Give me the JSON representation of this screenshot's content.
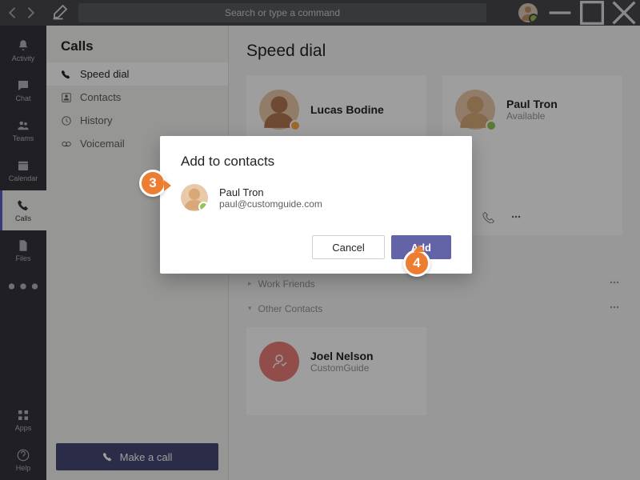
{
  "titlebar": {
    "search_placeholder": "Search or type a command"
  },
  "rail": {
    "activity": "Activity",
    "chat": "Chat",
    "teams": "Teams",
    "calendar": "Calendar",
    "calls": "Calls",
    "files": "Files",
    "apps": "Apps",
    "help": "Help"
  },
  "calls_panel": {
    "title": "Calls",
    "items": {
      "speed_dial": "Speed dial",
      "contacts": "Contacts",
      "history": "History",
      "voicemail": "Voicemail"
    },
    "make_call": "Make a call"
  },
  "content": {
    "title": "Speed dial",
    "contacts": [
      {
        "name": "Lucas Bodine",
        "status": ""
      },
      {
        "name": "Paul Tron",
        "status": "Available"
      }
    ],
    "groups": {
      "work_friends": "Work Friends",
      "other_contacts": "Other Contacts"
    },
    "joel": {
      "name": "Joel Nelson",
      "status": "CustomGuide"
    }
  },
  "modal": {
    "title": "Add to contacts",
    "name": "Paul Tron",
    "email": "paul@customguide.com",
    "cancel": "Cancel",
    "add": "Add"
  },
  "steps": {
    "s3": "3",
    "s4": "4"
  }
}
